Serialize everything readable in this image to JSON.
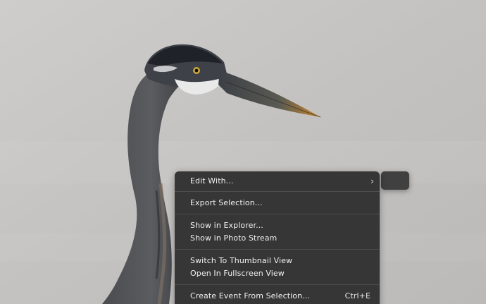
{
  "photo": {
    "subject_icon": "heron-photo",
    "background_color": "#c7c5c3"
  },
  "context_menu": {
    "items": [
      {
        "label": "Edit With...",
        "shortcut": "",
        "has_submenu": true,
        "chevron": "›"
      },
      {
        "label": "Export Selection...",
        "shortcut": ""
      },
      {
        "label": "Show in Explorer...",
        "shortcut": ""
      },
      {
        "label": "Show in Photo Stream",
        "shortcut": ""
      },
      {
        "label": "Switch To Thumbnail View",
        "shortcut": ""
      },
      {
        "label": "Open In Fullscreen View",
        "shortcut": ""
      },
      {
        "label": "Create Event From Selection...",
        "shortcut": "Ctrl+E"
      }
    ],
    "menu_color": "#363636",
    "text_color": "#f0f0f0"
  }
}
